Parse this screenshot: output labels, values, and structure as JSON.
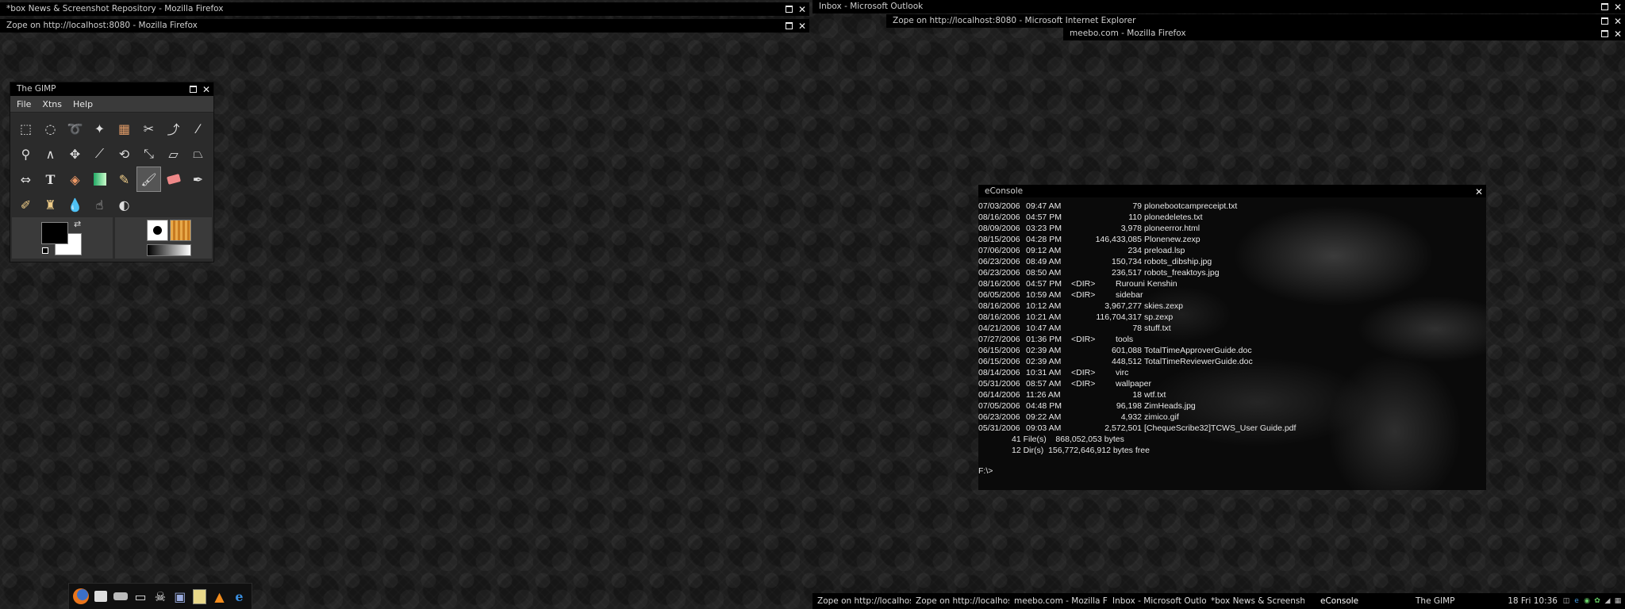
{
  "windows": {
    "firefox_box": "*box News & Screenshot Repository - Mozilla Firefox",
    "firefox_zope": "Zope on http://localhost:8080 - Mozilla Firefox",
    "outlook": "Inbox - Microsoft Outlook",
    "ie_zope": "Zope on http://localhost:8080 - Microsoft Internet Explorer",
    "meebo": "meebo.com - Mozilla Firefox"
  },
  "gimp": {
    "title": "The GIMP",
    "menu": {
      "file": "File",
      "xtns": "Xtns",
      "help": "Help"
    },
    "tools": [
      "rect-select-icon",
      "ellipse-select-icon",
      "lasso-icon",
      "fuzzy-select-icon",
      "color-select-icon",
      "scissors-icon",
      "paths-icon",
      "color-picker-icon",
      "magnify-icon",
      "measure-icon",
      "move-icon",
      "crop-icon",
      "rotate-icon",
      "scale-icon",
      "shear-icon",
      "perspective-icon",
      "flip-icon",
      "text-icon",
      "bucket-fill-icon",
      "blend-icon",
      "pencil-icon",
      "paintbrush-icon",
      "eraser-icon",
      "airbrush-icon",
      "ink-icon",
      "clone-icon",
      "blur-icon",
      "smudge-icon",
      "dodge-burn-icon"
    ],
    "active_tool": "paintbrush-icon"
  },
  "econsole": {
    "title": "eConsole",
    "rows": [
      {
        "date": "07/03/2006",
        "time": "09:47 AM",
        "size": "79",
        "dir": "",
        "name": "plonebootcampreceipt.txt"
      },
      {
        "date": "08/16/2006",
        "time": "04:57 PM",
        "size": "110",
        "dir": "",
        "name": "plonedeletes.txt"
      },
      {
        "date": "08/09/2006",
        "time": "03:23 PM",
        "size": "3,978",
        "dir": "",
        "name": "ploneerror.html"
      },
      {
        "date": "08/15/2006",
        "time": "04:28 PM",
        "size": "146,433,085",
        "dir": "",
        "name": "Plonenew.zexp"
      },
      {
        "date": "07/06/2006",
        "time": "09:12 AM",
        "size": "234",
        "dir": "",
        "name": "preload.lsp"
      },
      {
        "date": "06/23/2006",
        "time": "08:49 AM",
        "size": "150,734",
        "dir": "",
        "name": "robots_dibship.jpg"
      },
      {
        "date": "06/23/2006",
        "time": "08:50 AM",
        "size": "236,517",
        "dir": "",
        "name": "robots_freaktoys.jpg"
      },
      {
        "date": "08/16/2006",
        "time": "04:57 PM",
        "size": "",
        "dir": "<DIR>",
        "name": "Rurouni Kenshin"
      },
      {
        "date": "06/05/2006",
        "time": "10:59 AM",
        "size": "",
        "dir": "<DIR>",
        "name": "sidebar"
      },
      {
        "date": "08/16/2006",
        "time": "10:12 AM",
        "size": "3,967,277",
        "dir": "",
        "name": "skies.zexp"
      },
      {
        "date": "08/16/2006",
        "time": "10:21 AM",
        "size": "116,704,317",
        "dir": "",
        "name": "sp.zexp"
      },
      {
        "date": "04/21/2006",
        "time": "10:47 AM",
        "size": "78",
        "dir": "",
        "name": "stuff.txt"
      },
      {
        "date": "07/27/2006",
        "time": "01:36 PM",
        "size": "",
        "dir": "<DIR>",
        "name": "tools"
      },
      {
        "date": "06/15/2006",
        "time": "02:39 AM",
        "size": "601,088",
        "dir": "",
        "name": "TotalTimeApproverGuide.doc"
      },
      {
        "date": "06/15/2006",
        "time": "02:39 AM",
        "size": "448,512",
        "dir": "",
        "name": "TotalTimeReviewerGuide.doc"
      },
      {
        "date": "08/14/2006",
        "time": "10:31 AM",
        "size": "",
        "dir": "<DIR>",
        "name": "virc"
      },
      {
        "date": "05/31/2006",
        "time": "08:57 AM",
        "size": "",
        "dir": "<DIR>",
        "name": "wallpaper"
      },
      {
        "date": "06/14/2006",
        "time": "11:26 AM",
        "size": "18",
        "dir": "",
        "name": "wtf.txt"
      },
      {
        "date": "07/05/2006",
        "time": "04:48 PM",
        "size": "96,198",
        "dir": "",
        "name": "ZimHeads.jpg"
      },
      {
        "date": "06/23/2006",
        "time": "09:22 AM",
        "size": "4,932",
        "dir": "",
        "name": "zimico.gif"
      },
      {
        "date": "05/31/2006",
        "time": "09:03 AM",
        "size": "2,572,501",
        "dir": "",
        "name": "[ChequeScribe32]TCWS_User Guide.pdf"
      }
    ],
    "summary_files": "41 File(s)    868,052,053 bytes",
    "summary_dirs": "12 Dir(s)  156,772,646,912 bytes free",
    "prompt": "F:\\>"
  },
  "dock": {
    "icons": [
      "firefox-icon",
      "finder-icon",
      "disk-icon",
      "terminal-icon",
      "pirate-icon",
      "monitor-icon",
      "text-editor-icon",
      "vlc-icon",
      "ie-icon"
    ]
  },
  "taskbar": {
    "tasks": [
      "Zope on http://localhos...",
      "Zope on http://localhos...",
      "meebo.com - Mozilla Fir...",
      "Inbox - Microsoft Outlook",
      "*box News & Screensh...",
      "eConsole",
      "The GIMP"
    ],
    "clock": "18 Fri 10:36"
  }
}
